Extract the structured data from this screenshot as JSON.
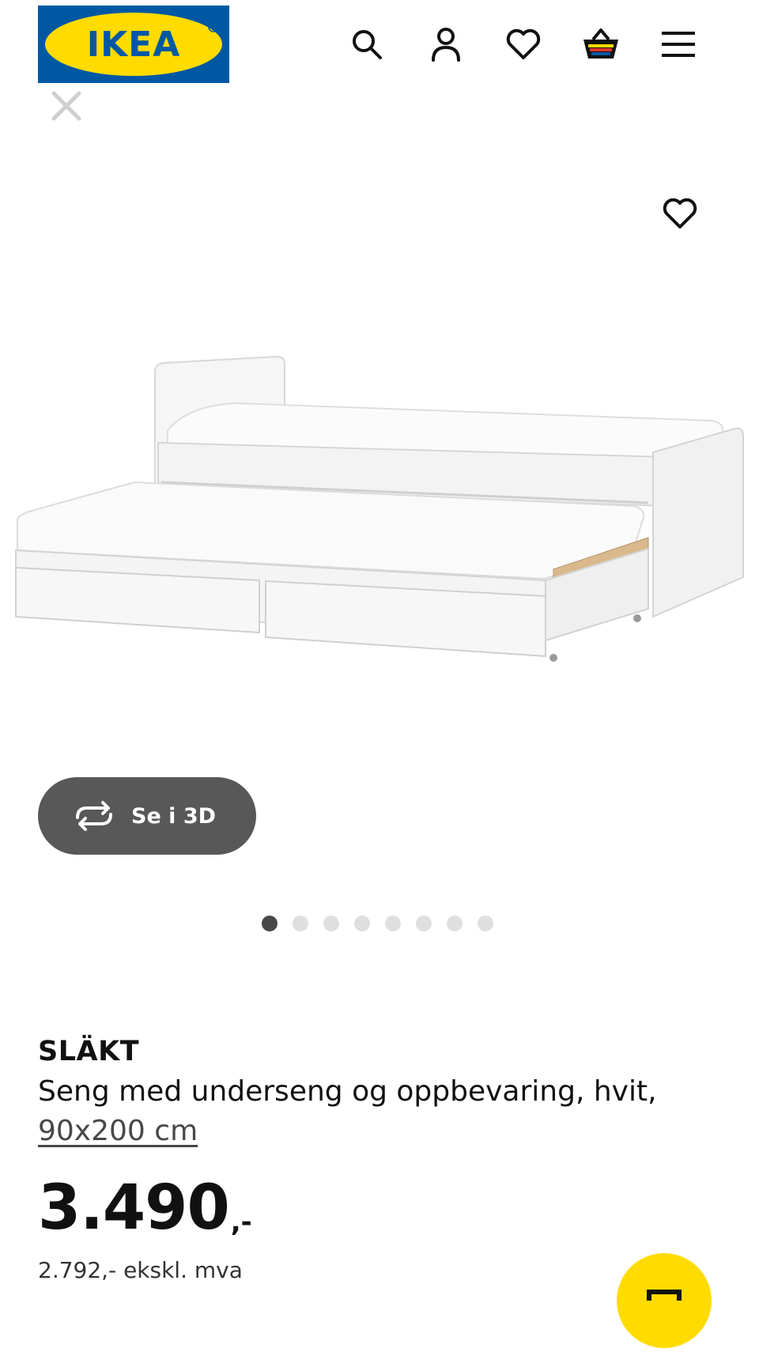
{
  "header": {
    "logo_text": "IKEA",
    "icons": [
      "search-icon",
      "user-icon",
      "heart-icon",
      "cart-icon",
      "menu-icon"
    ],
    "brand_colors": {
      "blue": "#0058a3",
      "yellow": "#ffdb00"
    }
  },
  "gallery": {
    "close_icon": "close-icon",
    "favorite_icon": "heart-icon",
    "view_3d_label": "Se i 3D",
    "total_images": 8,
    "active_index": 0
  },
  "product": {
    "name": "SLÄKT",
    "description": "Seng med underseng og oppbevaring, hvit,",
    "size": "90x200 cm",
    "price": "3.490",
    "price_suffix": ",-",
    "price_excl_vat": "2.792,- ekskl. mva"
  },
  "fab": {
    "icon": "cart-icon",
    "color": "#ffdb00"
  }
}
